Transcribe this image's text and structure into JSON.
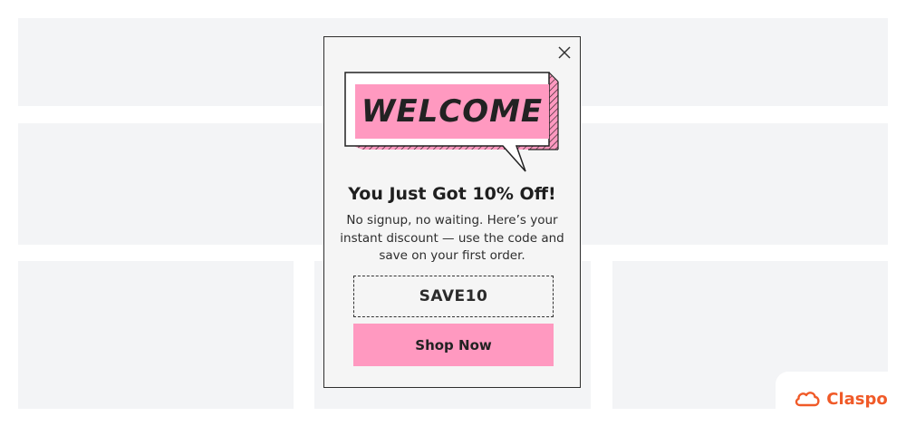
{
  "popup": {
    "headline_art_text": "WELCOME",
    "title": "You Just Got 10% Off!",
    "description": "No signup, no waiting. Here’s your instant discount — use the code and save on your first order.",
    "coupon_code": "SAVE10",
    "cta_label": "Shop Now",
    "close_icon": "close-icon"
  },
  "brand": {
    "name": "Claspo",
    "logo_icon": "cloud-icon"
  },
  "colors": {
    "accent_pink": "#ff99c0",
    "brand_orange": "#f05a28",
    "placeholder_gray": "#f3f4f6",
    "popup_bg": "#f5f5f5",
    "ink": "#222222"
  }
}
